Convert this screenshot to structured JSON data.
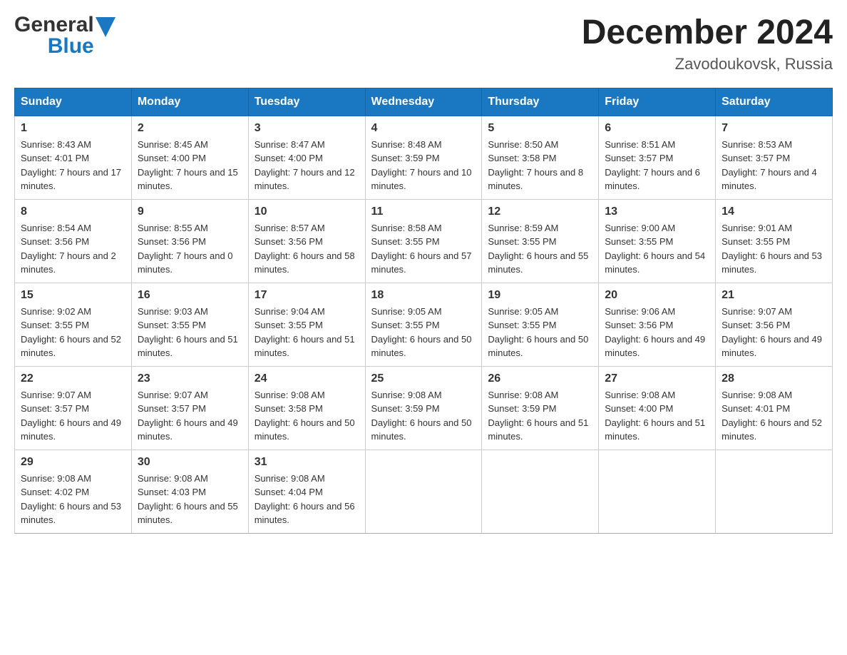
{
  "header": {
    "title": "December 2024",
    "subtitle": "Zavodoukovsk, Russia",
    "logo_general": "General",
    "logo_blue": "Blue"
  },
  "weekdays": [
    "Sunday",
    "Monday",
    "Tuesday",
    "Wednesday",
    "Thursday",
    "Friday",
    "Saturday"
  ],
  "weeks": [
    [
      {
        "day": "1",
        "sunrise": "8:43 AM",
        "sunset": "4:01 PM",
        "daylight": "7 hours and 17 minutes."
      },
      {
        "day": "2",
        "sunrise": "8:45 AM",
        "sunset": "4:00 PM",
        "daylight": "7 hours and 15 minutes."
      },
      {
        "day": "3",
        "sunrise": "8:47 AM",
        "sunset": "4:00 PM",
        "daylight": "7 hours and 12 minutes."
      },
      {
        "day": "4",
        "sunrise": "8:48 AM",
        "sunset": "3:59 PM",
        "daylight": "7 hours and 10 minutes."
      },
      {
        "day": "5",
        "sunrise": "8:50 AM",
        "sunset": "3:58 PM",
        "daylight": "7 hours and 8 minutes."
      },
      {
        "day": "6",
        "sunrise": "8:51 AM",
        "sunset": "3:57 PM",
        "daylight": "7 hours and 6 minutes."
      },
      {
        "day": "7",
        "sunrise": "8:53 AM",
        "sunset": "3:57 PM",
        "daylight": "7 hours and 4 minutes."
      }
    ],
    [
      {
        "day": "8",
        "sunrise": "8:54 AM",
        "sunset": "3:56 PM",
        "daylight": "7 hours and 2 minutes."
      },
      {
        "day": "9",
        "sunrise": "8:55 AM",
        "sunset": "3:56 PM",
        "daylight": "7 hours and 0 minutes."
      },
      {
        "day": "10",
        "sunrise": "8:57 AM",
        "sunset": "3:56 PM",
        "daylight": "6 hours and 58 minutes."
      },
      {
        "day": "11",
        "sunrise": "8:58 AM",
        "sunset": "3:55 PM",
        "daylight": "6 hours and 57 minutes."
      },
      {
        "day": "12",
        "sunrise": "8:59 AM",
        "sunset": "3:55 PM",
        "daylight": "6 hours and 55 minutes."
      },
      {
        "day": "13",
        "sunrise": "9:00 AM",
        "sunset": "3:55 PM",
        "daylight": "6 hours and 54 minutes."
      },
      {
        "day": "14",
        "sunrise": "9:01 AM",
        "sunset": "3:55 PM",
        "daylight": "6 hours and 53 minutes."
      }
    ],
    [
      {
        "day": "15",
        "sunrise": "9:02 AM",
        "sunset": "3:55 PM",
        "daylight": "6 hours and 52 minutes."
      },
      {
        "day": "16",
        "sunrise": "9:03 AM",
        "sunset": "3:55 PM",
        "daylight": "6 hours and 51 minutes."
      },
      {
        "day": "17",
        "sunrise": "9:04 AM",
        "sunset": "3:55 PM",
        "daylight": "6 hours and 51 minutes."
      },
      {
        "day": "18",
        "sunrise": "9:05 AM",
        "sunset": "3:55 PM",
        "daylight": "6 hours and 50 minutes."
      },
      {
        "day": "19",
        "sunrise": "9:05 AM",
        "sunset": "3:55 PM",
        "daylight": "6 hours and 50 minutes."
      },
      {
        "day": "20",
        "sunrise": "9:06 AM",
        "sunset": "3:56 PM",
        "daylight": "6 hours and 49 minutes."
      },
      {
        "day": "21",
        "sunrise": "9:07 AM",
        "sunset": "3:56 PM",
        "daylight": "6 hours and 49 minutes."
      }
    ],
    [
      {
        "day": "22",
        "sunrise": "9:07 AM",
        "sunset": "3:57 PM",
        "daylight": "6 hours and 49 minutes."
      },
      {
        "day": "23",
        "sunrise": "9:07 AM",
        "sunset": "3:57 PM",
        "daylight": "6 hours and 49 minutes."
      },
      {
        "day": "24",
        "sunrise": "9:08 AM",
        "sunset": "3:58 PM",
        "daylight": "6 hours and 50 minutes."
      },
      {
        "day": "25",
        "sunrise": "9:08 AM",
        "sunset": "3:59 PM",
        "daylight": "6 hours and 50 minutes."
      },
      {
        "day": "26",
        "sunrise": "9:08 AM",
        "sunset": "3:59 PM",
        "daylight": "6 hours and 51 minutes."
      },
      {
        "day": "27",
        "sunrise": "9:08 AM",
        "sunset": "4:00 PM",
        "daylight": "6 hours and 51 minutes."
      },
      {
        "day": "28",
        "sunrise": "9:08 AM",
        "sunset": "4:01 PM",
        "daylight": "6 hours and 52 minutes."
      }
    ],
    [
      {
        "day": "29",
        "sunrise": "9:08 AM",
        "sunset": "4:02 PM",
        "daylight": "6 hours and 53 minutes."
      },
      {
        "day": "30",
        "sunrise": "9:08 AM",
        "sunset": "4:03 PM",
        "daylight": "6 hours and 55 minutes."
      },
      {
        "day": "31",
        "sunrise": "9:08 AM",
        "sunset": "4:04 PM",
        "daylight": "6 hours and 56 minutes."
      },
      null,
      null,
      null,
      null
    ]
  ]
}
